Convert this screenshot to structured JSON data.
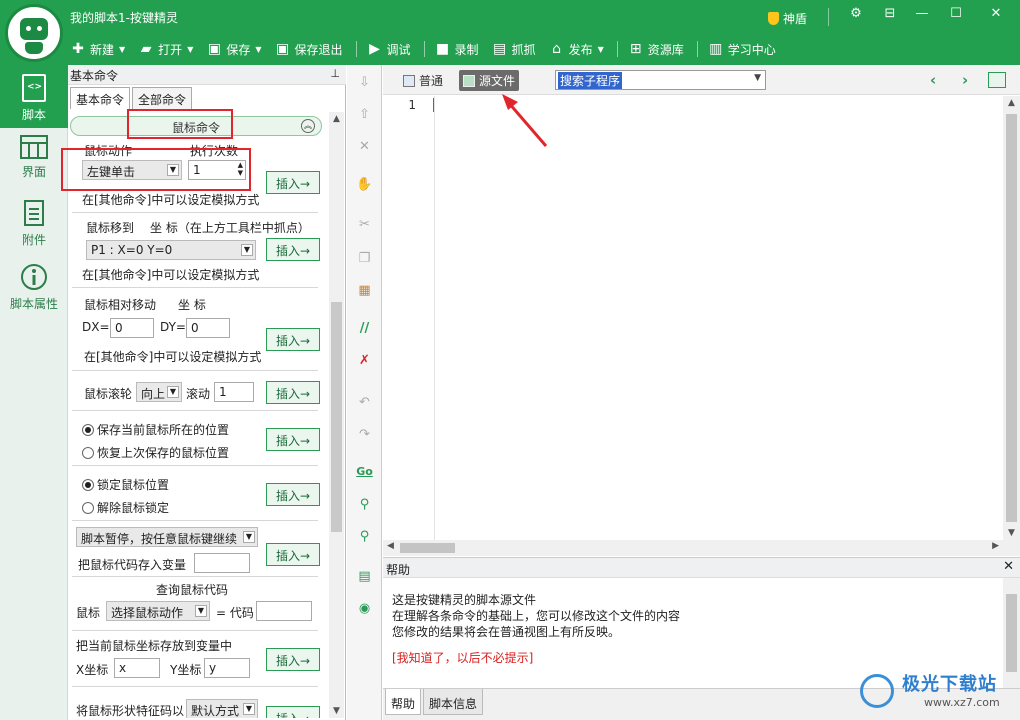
{
  "window": {
    "title": "我的脚本1-按键精灵",
    "shendun_label": "神盾"
  },
  "toolbar": {
    "new_label": "新建",
    "open_label": "打开",
    "save_label": "保存",
    "save_exit_label": "保存退出",
    "debug_label": "调试",
    "record_label": "录制",
    "capture_label": "抓抓",
    "publish_label": "发布",
    "resource_label": "资源库",
    "learn_label": "学习中心"
  },
  "leftnav": {
    "items": [
      {
        "label": "脚本"
      },
      {
        "label": "界面"
      },
      {
        "label": "附件"
      },
      {
        "label": "脚本属性"
      }
    ]
  },
  "cmdpanel": {
    "header": "基本命令",
    "tabs": [
      "基本命令",
      "全部命令"
    ],
    "section_title": "鼠标命令",
    "insert_label": "插入→",
    "mouse_action": {
      "label": "鼠标动作",
      "count_label": "执行次数",
      "action_value": "左键单击",
      "count_value": "1",
      "note": "在[其他命令]中可以设定模拟方式"
    },
    "mouse_move": {
      "label": "鼠标移到",
      "coord_label": "坐 标（在上方工具栏中抓点）",
      "point_value": "P1 : X=0 Y=0",
      "note": "在[其他命令]中可以设定模拟方式"
    },
    "mouse_rel": {
      "label": "鼠标相对移动",
      "coord_label": "坐 标",
      "dx_label": "DX=",
      "dx_value": "0",
      "dy_label": "DY=",
      "dy_value": "0",
      "note": "在[其他命令]中可以设定模拟方式"
    },
    "wheel": {
      "label": "鼠标滚轮",
      "dir_value": "向上",
      "scroll_label": "滚动",
      "scroll_value": "1"
    },
    "save_pos": {
      "option1": "保存当前鼠标所在的位置",
      "option2": "恢复上次保存的鼠标位置"
    },
    "lock": {
      "option1": "锁定鼠标位置",
      "option2": "解除鼠标锁定"
    },
    "pause": {
      "select_value": "脚本暂停，按任意鼠标键继续",
      "store_label": "把鼠标代码存入变量"
    },
    "query": {
      "title": "查询鼠标代码",
      "mouse_label": "鼠标",
      "select_value": "选择鼠标动作",
      "eq_label": "= 代码"
    },
    "store_coord": {
      "title": "把当前鼠标坐标存放到变量中",
      "x_label": "X坐标",
      "x_value": "x",
      "y_label": "Y坐标",
      "y_value": "y"
    },
    "shape": {
      "label": "将鼠标形状特征码以",
      "select_value": "默认方式"
    }
  },
  "editor": {
    "tab_normal": "普通",
    "tab_source": "源文件",
    "sub_search": "搜索子程序",
    "line_number": "1"
  },
  "help": {
    "header": "帮助",
    "lines": [
      "这是按键精灵的脚本源文件",
      "在理解各条命令的基础上，您可以修改这个文件的内容",
      "您修改的结果将会在普通视图上有所反映。"
    ],
    "dismiss_link": "[我知道了，以后不必提示]",
    "tabs": [
      "帮助",
      "脚本信息"
    ]
  },
  "watermark": {
    "text": "极光下载站",
    "url": "www.xz7.com"
  },
  "colors": {
    "brand_green": "#22a04f",
    "annotation_red": "#e0262c"
  }
}
